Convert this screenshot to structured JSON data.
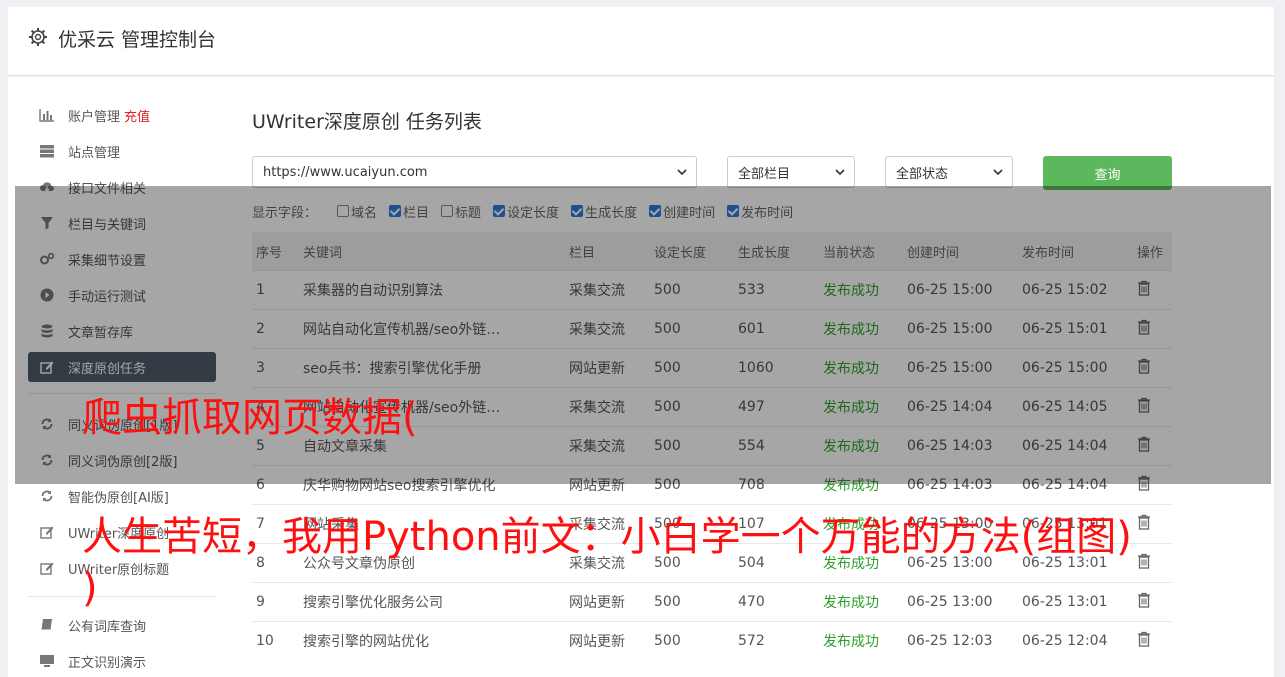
{
  "header": {
    "title": "优采云 管理控制台",
    "icon": "gear-icon"
  },
  "sidebar": {
    "items": [
      {
        "label": "账户管理",
        "badge": "充值",
        "icon": "bar-chart-icon"
      },
      {
        "label": "站点管理",
        "icon": "server-icon"
      },
      {
        "label": "接口文件相关",
        "icon": "cloud-download-icon"
      },
      {
        "label": "栏目与关键词",
        "icon": "filter-icon"
      },
      {
        "label": "采集细节设置",
        "icon": "cogs-icon"
      },
      {
        "label": "手动运行测试",
        "icon": "play-icon"
      },
      {
        "label": "文章暂存库",
        "icon": "database-icon"
      },
      {
        "label": "深度原创任务",
        "icon": "edit-icon"
      },
      {
        "label": "同义词伪原创[1版]",
        "icon": "refresh-icon"
      },
      {
        "label": "同义词伪原创[2版]",
        "icon": "refresh-icon"
      },
      {
        "label": "智能伪原创[AI版]",
        "icon": "refresh-icon"
      },
      {
        "label": "UWriter深度原创",
        "icon": "edit-icon"
      },
      {
        "label": "UWriter原创标题",
        "icon": "edit-icon"
      },
      {
        "label": "公有词库查询",
        "icon": "book-icon"
      },
      {
        "label": "正文识别演示",
        "icon": "monitor-icon"
      }
    ]
  },
  "main": {
    "title": "UWriter深度原创 任务列表",
    "site_select": "https://www.ucaiyun.com",
    "column_select": "全部栏目",
    "status_select": "全部状态",
    "query_label": "查询",
    "fields_label": "显示字段：",
    "fields": [
      {
        "label": "域名",
        "checked": false
      },
      {
        "label": "栏目",
        "checked": true
      },
      {
        "label": "标题",
        "checked": false
      },
      {
        "label": "设定长度",
        "checked": true
      },
      {
        "label": "生成长度",
        "checked": true
      },
      {
        "label": "创建时间",
        "checked": true
      },
      {
        "label": "发布时间",
        "checked": true
      }
    ],
    "columns": [
      "序号",
      "关键词",
      "栏目",
      "设定长度",
      "生成长度",
      "当前状态",
      "创建时间",
      "发布时间",
      "操作"
    ],
    "rows": [
      [
        "1",
        "采集器的自动识别算法",
        "采集交流",
        "500",
        "533",
        "发布成功",
        "06-25 15:00",
        "06-25 15:02"
      ],
      [
        "2",
        "网站自动化宣传机器/seo外链…",
        "采集交流",
        "500",
        "601",
        "发布成功",
        "06-25 15:00",
        "06-25 15:01"
      ],
      [
        "3",
        "seo兵书：搜索引擎优化手册",
        "网站更新",
        "500",
        "1060",
        "发布成功",
        "06-25 15:00",
        "06-25 15:00"
      ],
      [
        "4",
        "网站自动化宣传机器/seo外链…",
        "采集交流",
        "500",
        "497",
        "发布成功",
        "06-25 14:04",
        "06-25 14:05"
      ],
      [
        "5",
        "自动文章采集",
        "采集交流",
        "500",
        "554",
        "发布成功",
        "06-25 14:03",
        "06-25 14:04"
      ],
      [
        "6",
        "庆华购物网站seo搜索引擎优化",
        "网站更新",
        "500",
        "708",
        "发布成功",
        "06-25 14:03",
        "06-25 14:04"
      ],
      [
        "7",
        "网站采集",
        "采集交流",
        "500",
        "107",
        "发布成功",
        "06-25 13:00",
        "06-25 13:01"
      ],
      [
        "8",
        "公众号文章伪原创",
        "采集交流",
        "500",
        "504",
        "发布成功",
        "06-25 13:00",
        "06-25 13:01"
      ],
      [
        "9",
        "搜索引擎优化服务公司",
        "网站更新",
        "500",
        "470",
        "发布成功",
        "06-25 13:00",
        "06-25 13:01"
      ],
      [
        "10",
        "搜索引擎的网站优化",
        "网站更新",
        "500",
        "572",
        "发布成功",
        "06-25 12:03",
        "06-25 12:04"
      ]
    ],
    "delete_icon": "trash-icon"
  },
  "overlay": {
    "line1": "爬虫抓取网页数据(",
    "line2": "人生苦短，我用Python前文：小白学一个万能的方法(组图)",
    "line3": ")"
  },
  "colors": {
    "accent_green": "#5cb85c",
    "status_green": "#2ca02c",
    "overlay_red": "#ff1010",
    "sidebar_active": "#4f5b6a"
  }
}
